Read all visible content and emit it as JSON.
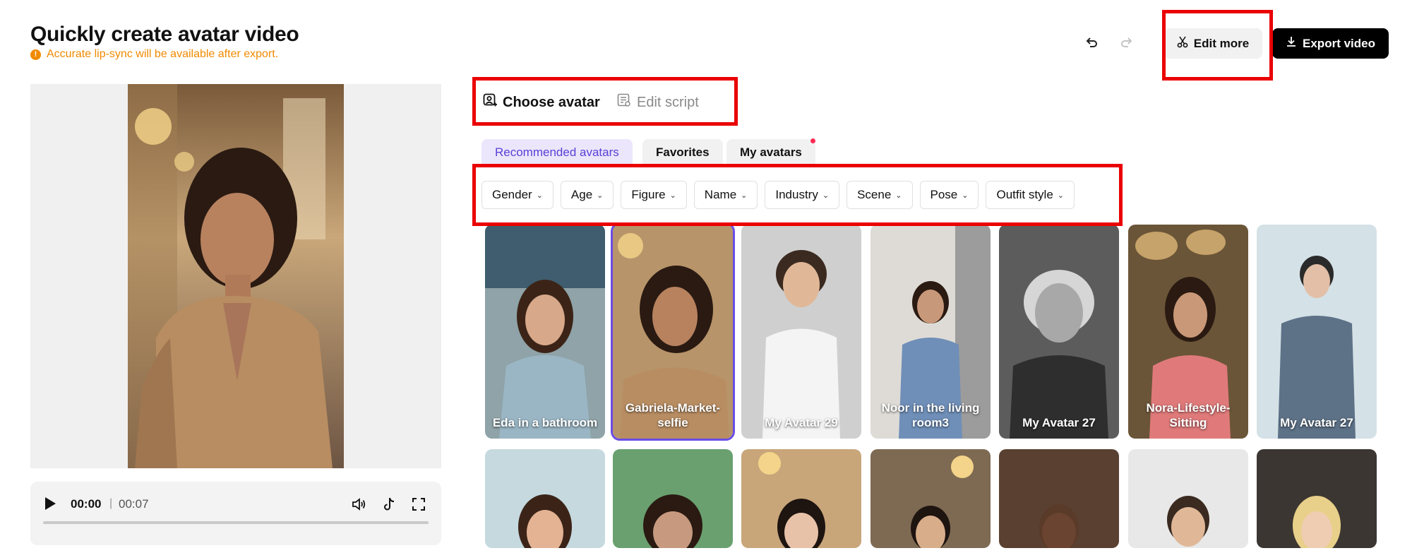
{
  "header": {
    "title": "Quickly create avatar video",
    "notice": "Accurate lip-sync will be available after export."
  },
  "toolbar": {
    "undo_icon": "undo-icon",
    "redo_icon": "redo-icon",
    "edit_more_label": "Edit more",
    "export_label": "Export video"
  },
  "player": {
    "current_time": "00:00",
    "separator": "|",
    "total_time": "00:07",
    "progress": 0
  },
  "main_tabs": [
    {
      "label": "Choose avatar",
      "active": true
    },
    {
      "label": "Edit script",
      "active": false
    }
  ],
  "sub_tabs": [
    {
      "label": "Recommended avatars",
      "active": true
    },
    {
      "label": "Favorites",
      "active": false
    },
    {
      "label": "My avatars",
      "active": false,
      "has_dot": true
    }
  ],
  "filters": [
    "Gender",
    "Age",
    "Figure",
    "Name",
    "Industry",
    "Scene",
    "Pose",
    "Outfit style"
  ],
  "avatars_row1": [
    {
      "name": "Eda in a bathroom"
    },
    {
      "name": "Gabriela-Market-selfie",
      "selected": true
    },
    {
      "name": "My Avatar 29"
    },
    {
      "name": "Noor in the living room3"
    },
    {
      "name": "My Avatar 27"
    },
    {
      "name": "Nora-Lifestyle-Sitting"
    },
    {
      "name": "My Avatar 27"
    }
  ],
  "colors": {
    "accent": "#6a4de6",
    "warning": "#f08a00",
    "highlight_box": "#ea0000"
  }
}
